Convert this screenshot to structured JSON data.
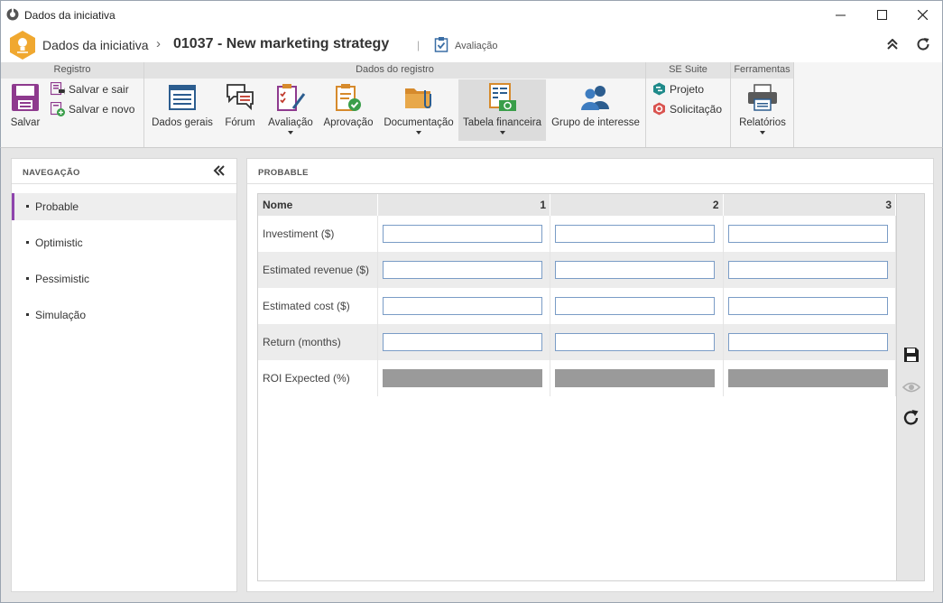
{
  "window": {
    "title": "Dados da iniciativa"
  },
  "header": {
    "breadcrumb_root": "Dados da iniciativa",
    "breadcrumb_sep": "›",
    "record_title": "01037 - New marketing strategy",
    "separator": "|",
    "status_label": "Avaliação"
  },
  "ribbon": {
    "groups": {
      "registro": "Registro",
      "dados_registro": "Dados do registro",
      "se_suite": "SE Suite",
      "ferramentas": "Ferramentas"
    },
    "salvar": "Salvar",
    "salvar_sair": "Salvar e sair",
    "salvar_novo": "Salvar e novo",
    "dados_gerais": "Dados gerais",
    "forum": "Fórum",
    "avaliacao": "Avaliação",
    "aprovacao": "Aprovação",
    "documentacao": "Documentação",
    "tabela_financeira": "Tabela financeira",
    "grupo_interesse": "Grupo de interesse",
    "projeto": "Projeto",
    "solicitacao": "Solicitação",
    "relatorios": "Relatórios"
  },
  "nav": {
    "title": "NAVEGAÇÃO",
    "items": [
      {
        "label": "Probable",
        "active": true
      },
      {
        "label": "Optimistic",
        "active": false
      },
      {
        "label": "Pessimistic",
        "active": false
      },
      {
        "label": "Simulação",
        "active": false
      }
    ]
  },
  "content": {
    "title": "PROBABLE",
    "table": {
      "header_name": "Nome",
      "columns": [
        "1",
        "2",
        "3"
      ],
      "rows": [
        {
          "name": "Investiment ($)",
          "values": [
            "",
            "",
            ""
          ],
          "readonly": false
        },
        {
          "name": "Estimated revenue ($)",
          "values": [
            "",
            "",
            ""
          ],
          "readonly": false
        },
        {
          "name": "Estimated cost ($)",
          "values": [
            "",
            "",
            ""
          ],
          "readonly": false
        },
        {
          "name": "Return (months)",
          "values": [
            "",
            "",
            ""
          ],
          "readonly": false
        },
        {
          "name": "ROI Expected (%)",
          "values": [
            "",
            "",
            ""
          ],
          "readonly": true
        }
      ]
    }
  },
  "colors": {
    "accent": "#8e44ad",
    "input_border": "#7a9cc6",
    "readonly_fill": "#9a9a9a",
    "logo": "#f0a830"
  }
}
